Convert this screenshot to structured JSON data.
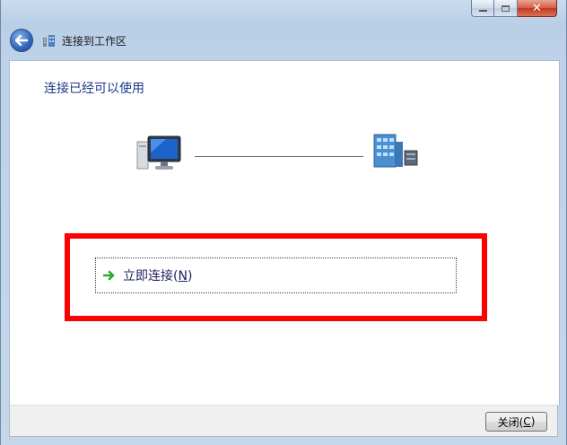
{
  "window": {
    "title": "连接到工作区",
    "controls": {
      "minimize": "minimize",
      "maximize": "maximize",
      "close": "close"
    }
  },
  "main": {
    "heading": "连接已经可以使用",
    "connect_label": "立即连接(",
    "connect_hotkey": "N",
    "connect_suffix": ")"
  },
  "footer": {
    "close_label": "关闭(",
    "close_hotkey": "C",
    "close_suffix": ")"
  },
  "colors": {
    "heading": "#1e3a8a",
    "highlight_box": "#ff0000",
    "arrow": "#2eaa2e"
  },
  "icons": [
    "back-arrow-icon",
    "workplace-network-icon",
    "computer-icon",
    "server-icon",
    "green-arrow-icon"
  ]
}
